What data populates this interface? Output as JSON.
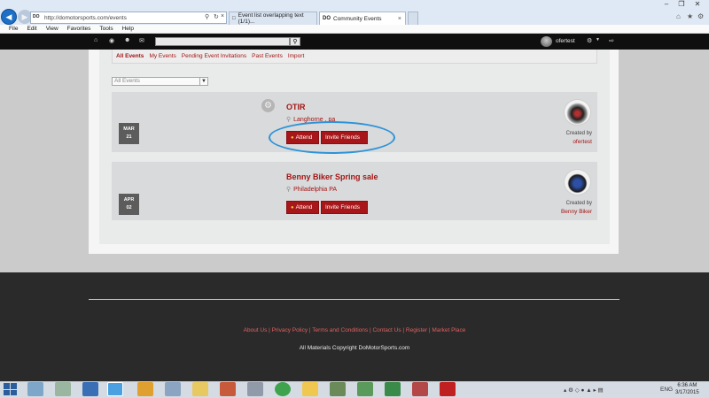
{
  "browser": {
    "address_url": "http://domotorsports.com/events",
    "tabs": [
      {
        "label": "Event list overlapping text (1/1)..."
      },
      {
        "label": "Community Events"
      }
    ],
    "menu": [
      "File",
      "Edit",
      "View",
      "Favorites",
      "Tools",
      "Help"
    ]
  },
  "navbar": {
    "username": "ofertest"
  },
  "subnav": [
    "All Events",
    "My Events",
    "Pending Event Invitations",
    "Past Events",
    "Import"
  ],
  "filter": {
    "selected": "All Events"
  },
  "events": [
    {
      "month": "MAR",
      "day": "21",
      "title": "OTIR",
      "location": "Langhorne , pa",
      "attend_label": "Attend",
      "invite_label": "Invite Friends",
      "created_by_label": "Created by",
      "creator": "ofertest"
    },
    {
      "month": "APR",
      "day": "02",
      "title": "Benny Biker Spring sale",
      "location": "Philadelphia PA",
      "attend_label": "Attend",
      "invite_label": "Invite Friends",
      "created_by_label": "Created by",
      "creator": "Benny Biker"
    }
  ],
  "footer": {
    "links": "About Us | Privacy Policy | Terms and Conditions | Contact Us | Register | Market Place",
    "copyright": "All Materials Copyright DoMotorSports.com"
  },
  "taskbar": {
    "lang": "ENG",
    "time": "6:36 AM",
    "date": "3/17/2015"
  },
  "colors": {
    "brand_red": "#a31515",
    "button_red": "#a71618",
    "highlight_circle": "#2d93d8"
  }
}
